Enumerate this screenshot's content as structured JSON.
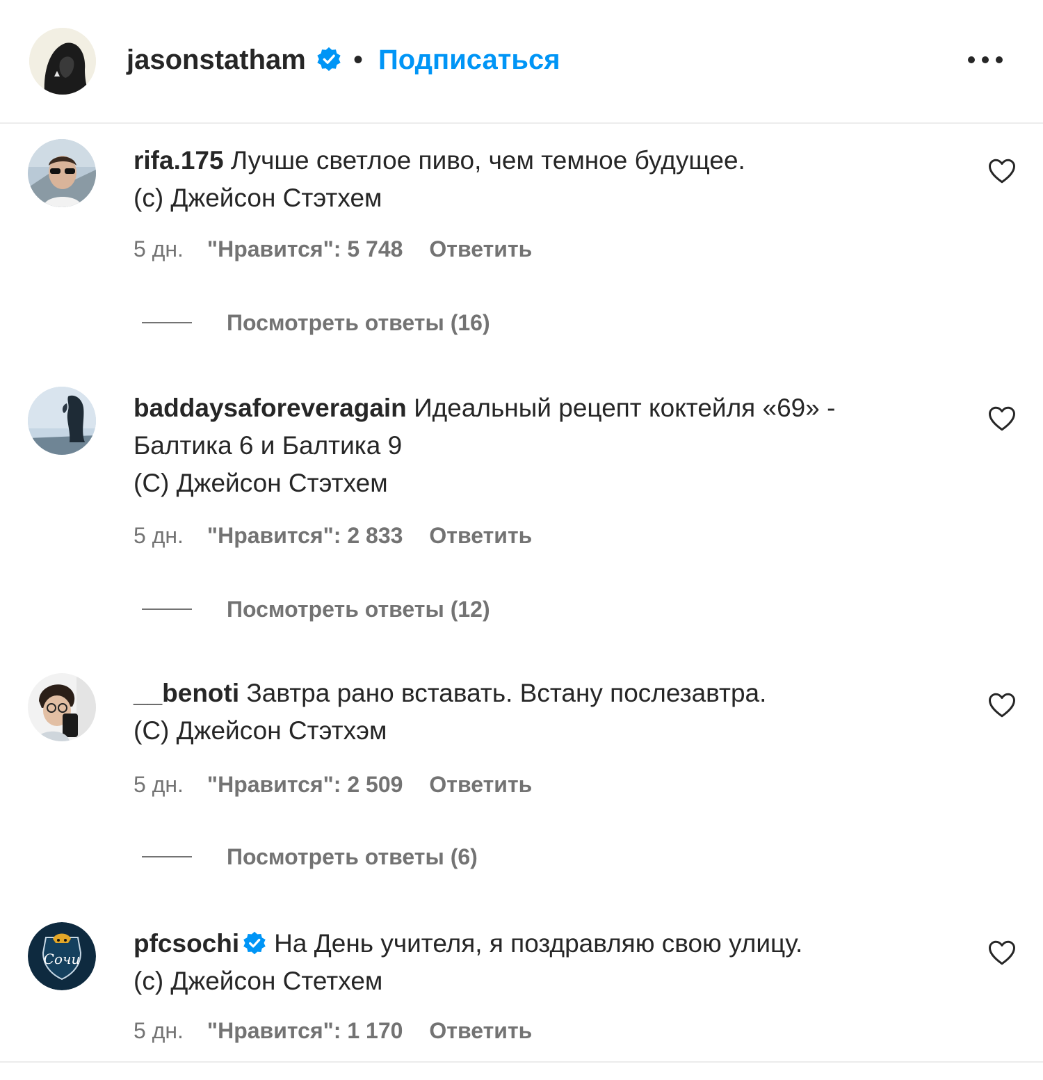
{
  "post_header": {
    "username": "jasonstatham",
    "separator": "•",
    "follow_label": "Подписаться"
  },
  "comments": [
    {
      "username": "rifa.175",
      "text": "Лучше светлое пиво, чем темное будущее.\n(с) Джейсон Стэтхем",
      "time": "5 дн.",
      "likes": "\"Нравится\": 5 748",
      "reply_label": "Ответить",
      "view_replies": "Посмотреть ответы (16)"
    },
    {
      "username": "baddaysaforeveragain",
      "text": "Идеальный рецепт коктейля «69» -\nБалтика 6 и Балтика 9\n(С) Джейсон Стэтхем",
      "time": "5 дн.",
      "likes": "\"Нравится\": 2 833",
      "reply_label": "Ответить",
      "view_replies": "Посмотреть ответы (12)"
    },
    {
      "username": "__benoti",
      "text": "Завтра рано вставать. Встану послезавтра.\n(С) Джейсон Стэтхэм",
      "time": "5 дн.",
      "likes": "\"Нравится\": 2 509",
      "reply_label": "Ответить",
      "view_replies": "Посмотреть ответы (6)"
    },
    {
      "username": "pfcsochi",
      "text": "На День учителя, я поздравляю свою улицу.\n(с) Джейсон Стетхем",
      "time": "5 дн.",
      "likes": "\"Нравится\": 1 170",
      "reply_label": "Ответить",
      "avatar_logo_text": "Сочи"
    }
  ],
  "colors": {
    "text": "#262626",
    "secondary": "#737373",
    "link": "#0095f6",
    "divider": "#ececec"
  }
}
